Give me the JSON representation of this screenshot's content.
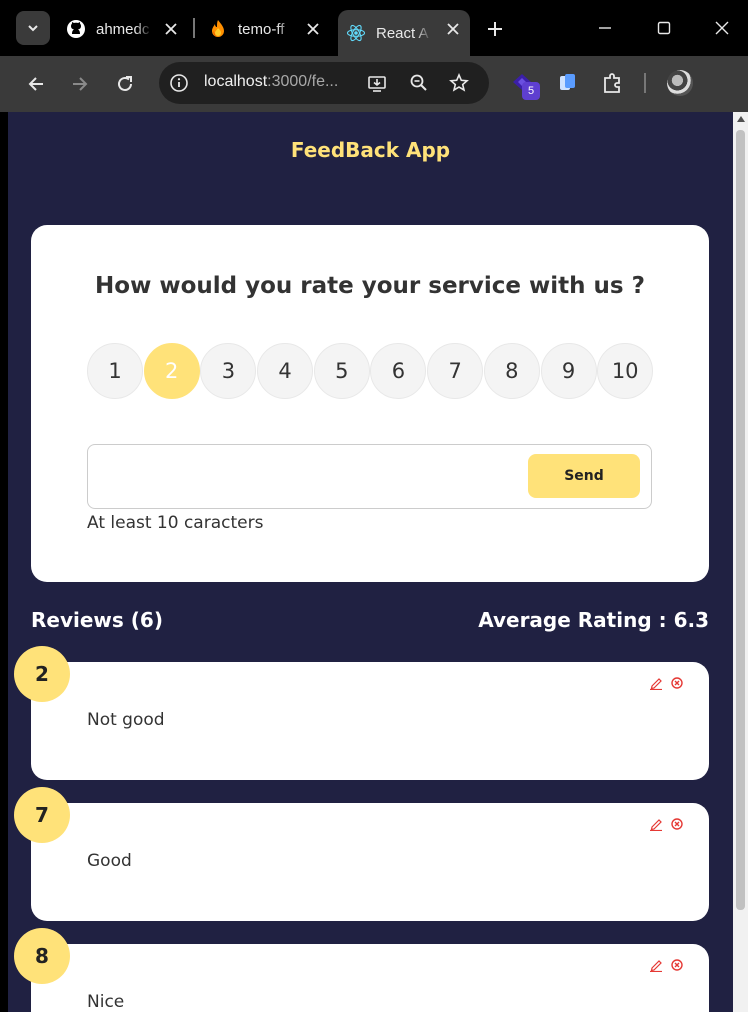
{
  "browser": {
    "tabs": [
      {
        "title": "ahmedc",
        "icon": "github-icon",
        "active": false
      },
      {
        "title": "temo-ff",
        "icon": "firebase-icon",
        "active": false
      },
      {
        "title": "React A",
        "icon": "react-icon",
        "active": true
      }
    ],
    "url_host": "localhost",
    "url_rest": ":3000/fe...",
    "extension_badge": "5"
  },
  "app": {
    "title": "FeedBack App",
    "question": "How would you rate your service with us ?",
    "ratings": [
      "1",
      "2",
      "3",
      "4",
      "5",
      "6",
      "7",
      "8",
      "9",
      "10"
    ],
    "selected_rating": "2",
    "input": {
      "value": "",
      "placeholder": ""
    },
    "send_label": "Send",
    "hint": "At least 10 caracters",
    "reviews_label": "Reviews (6)",
    "average_label": "Average Rating : 6.3",
    "reviews": [
      {
        "rating": "2",
        "text": "Not good"
      },
      {
        "rating": "7",
        "text": "Good"
      },
      {
        "rating": "8",
        "text": "Nice"
      }
    ]
  },
  "colors": {
    "page_bg": "#202142",
    "accent": "#ffe279",
    "delete": "#e53935"
  }
}
